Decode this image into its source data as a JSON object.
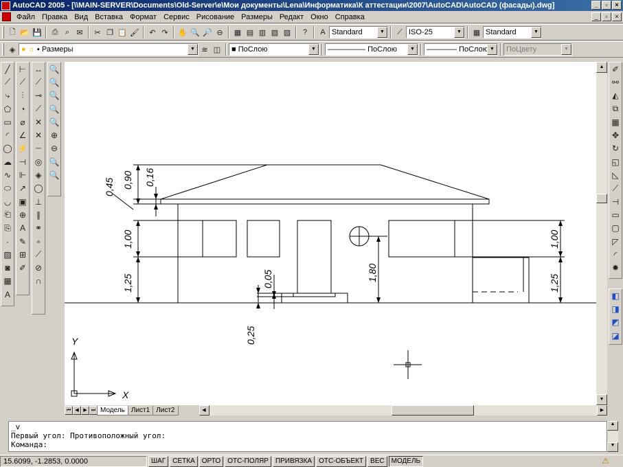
{
  "window": {
    "title": "AutoCAD 2005 - [\\\\MAIN-SERVER\\Documents\\Old-Server\\e\\Мои документы\\Lena\\Информатика\\К аттестации\\2007\\AutoCAD\\AutoCAD (фасады).dwg]"
  },
  "menu": [
    "Файл",
    "Правка",
    "Вид",
    "Вставка",
    "Формат",
    "Сервис",
    "Рисование",
    "Размеры",
    "Редакт",
    "Окно",
    "Справка"
  ],
  "toolbar": {
    "text_style": "Standard",
    "dim_style": "ISO-25",
    "table_style": "Standard"
  },
  "layers": {
    "current_layer": "Размеры",
    "color": "ПоСлою",
    "linetype": "ПоСлою",
    "lineweight": "ПоСлою",
    "plot_style": "ПоЦвету"
  },
  "drawing": {
    "dimensions": {
      "d045": "0,45",
      "d090": "0,90",
      "d016": "0,16",
      "d100_left": "1,00",
      "d125_left": "1,25",
      "d005": "0,05",
      "d025": "0,25",
      "d180": "1,80",
      "d100_right": "1,00",
      "d125_right": "1,25"
    },
    "ucs": {
      "x_label": "X",
      "y_label": "Y"
    }
  },
  "layout_tabs": [
    "Модель",
    "Лист1",
    "Лист2"
  ],
  "command": {
    "line1": "_v",
    "line2": "Первый угол: Противоположный угол:",
    "prompt": "Команда:"
  },
  "status": {
    "coords": "15.6099, -1.2853, 0.0000",
    "buttons": [
      "ШАГ",
      "СЕТКА",
      "ОРТО",
      "ОТС-ПОЛЯР",
      "ПРИВЯЗКА",
      "ОТС-ОБЪЕКТ",
      "ВЕС",
      "МОДЕЛЬ"
    ]
  }
}
